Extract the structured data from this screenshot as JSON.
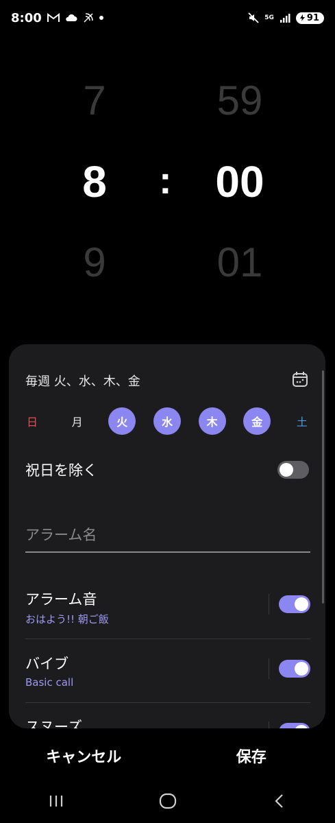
{
  "status_bar": {
    "time": "8:00",
    "network": "5G",
    "battery": "91",
    "icons": [
      "gmail-icon",
      "cloud-icon",
      "wifi-calling-icon",
      "dot-icon",
      "mute-icon",
      "signal-icon",
      "battery-icon"
    ]
  },
  "picker": {
    "hour_prev": "7",
    "hour_current": "8",
    "hour_next": "9",
    "separator": ":",
    "minute_prev": "59",
    "minute_current": "00",
    "minute_next": "01"
  },
  "repeat": {
    "text": "毎週 火、水、木、金",
    "icon": "calendar-icon"
  },
  "days": [
    {
      "label": "日",
      "selected": false
    },
    {
      "label": "月",
      "selected": false
    },
    {
      "label": "火",
      "selected": true
    },
    {
      "label": "水",
      "selected": true
    },
    {
      "label": "木",
      "selected": true
    },
    {
      "label": "金",
      "selected": true
    },
    {
      "label": "土",
      "selected": false
    }
  ],
  "holiday": {
    "label": "祝日を除く",
    "enabled": false
  },
  "alarm_name": {
    "value": "",
    "placeholder": "アラーム名"
  },
  "alarm_sound": {
    "title": "アラーム音",
    "value": "おはよう!! 朝ご飯",
    "enabled": true
  },
  "vibration": {
    "title": "バイブ",
    "value": "Basic call",
    "enabled": true
  },
  "next_item": {
    "title": "スヌーズ",
    "enabled": true
  },
  "actions": {
    "cancel": "キャンセル",
    "save": "保存"
  },
  "colors": {
    "accent": "#8b86f0",
    "sunday": "#e05252",
    "saturday": "#4a9be8",
    "card": "#1c1c1e"
  }
}
